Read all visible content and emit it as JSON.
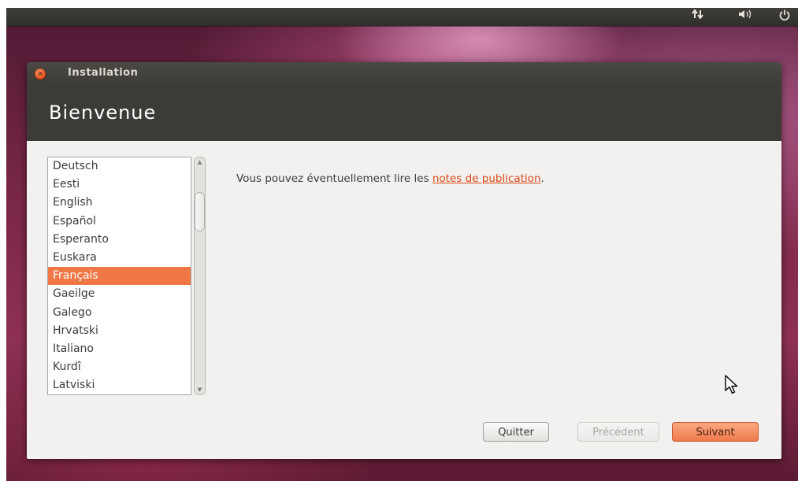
{
  "panel": {
    "network_icon": "network-arrows-icon",
    "volume_icon": "volume-icon",
    "power_icon": "power-icon"
  },
  "window": {
    "title": "Installation",
    "close_icon": "close-icon"
  },
  "header": {
    "title": "Bienvenue"
  },
  "languages": {
    "items": [
      "Deutsch",
      "Eesti",
      "English",
      "Español",
      "Esperanto",
      "Euskara",
      "Français",
      "Gaeilge",
      "Galego",
      "Hrvatski",
      "Italiano",
      "Kurdî",
      "Latviski"
    ],
    "selected": "Français"
  },
  "release": {
    "prefix": "Vous pouvez éventuellement lire les ",
    "link": "notes de publication",
    "suffix": "."
  },
  "buttons": {
    "quit": "Quitter",
    "previous": "Précédent",
    "next": "Suivant"
  },
  "colors": {
    "accent": "#f07746",
    "link": "#dd4814",
    "header_bg": "#3c3b37"
  }
}
